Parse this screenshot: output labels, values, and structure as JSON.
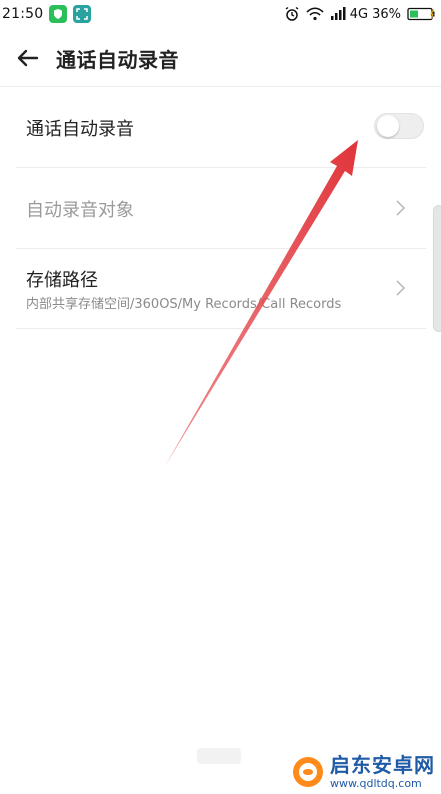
{
  "status_bar": {
    "time": "21:50",
    "network": "4G",
    "battery_percent": "36%",
    "icons": [
      "shield-app-icon",
      "scan-app-icon",
      "alarm-icon",
      "wifi-icon",
      "signal-icon",
      "battery-icon"
    ]
  },
  "header": {
    "title": "通话自动录音",
    "back_icon": "arrow-left-icon"
  },
  "settings": [
    {
      "id": "auto-record",
      "label": "通话自动录音",
      "type": "toggle",
      "enabled": false
    },
    {
      "id": "record-target",
      "label": "自动录音对象",
      "type": "nav",
      "disabled": true
    },
    {
      "id": "storage-path",
      "label": "存储路径",
      "subtitle": "内部共享存储空间/360OS/My Records/Call Records",
      "type": "nav"
    }
  ],
  "watermark": {
    "text": "启东安卓网",
    "url": "www.qdltdq.com"
  },
  "colors": {
    "arrow_red": "#e0343a",
    "watermark_blue": "#1f5aa6",
    "toggle_off": "#eeeeee"
  }
}
